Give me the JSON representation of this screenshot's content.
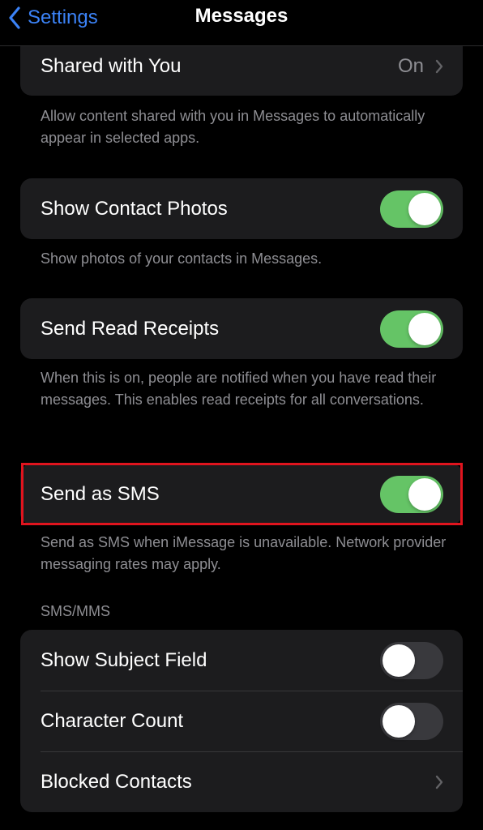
{
  "nav": {
    "back_label": "Settings",
    "title": "Messages"
  },
  "shared_with_you": {
    "label": "Shared with You",
    "value": "On",
    "footer": "Allow content shared with you in Messages to automatically appear in selected apps."
  },
  "show_contact_photos": {
    "label": "Show Contact Photos",
    "enabled": true,
    "footer": "Show photos of your contacts in Messages."
  },
  "send_read_receipts": {
    "label": "Send Read Receipts",
    "enabled": true,
    "footer": "When this is on, people are notified when you have read their messages. This enables read receipts for all conversations."
  },
  "send_as_sms": {
    "label": "Send as SMS",
    "enabled": true,
    "footer": "Send as SMS when iMessage is unavailable. Network provider messaging rates may apply."
  },
  "sms_mms": {
    "header": "SMS/MMS",
    "show_subject_field": {
      "label": "Show Subject Field",
      "enabled": false
    },
    "character_count": {
      "label": "Character Count",
      "enabled": false
    },
    "blocked_contacts": {
      "label": "Blocked Contacts"
    }
  },
  "colors": {
    "accent": "#3b82f6",
    "toggle_on": "#65c466",
    "highlight": "#e0141e"
  }
}
